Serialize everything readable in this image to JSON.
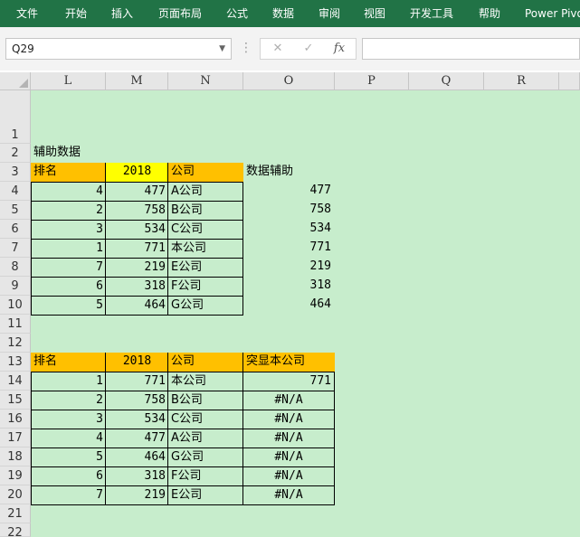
{
  "ribbon": {
    "tabs": [
      "文件",
      "开始",
      "插入",
      "页面布局",
      "公式",
      "数据",
      "审阅",
      "视图",
      "开发工具",
      "帮助",
      "Power Pivo"
    ]
  },
  "formula_bar": {
    "name_box": "Q29",
    "cancel_icon": "✕",
    "enter_icon": "✓",
    "fx_label": "fx",
    "formula": ""
  },
  "columns": [
    "L",
    "M",
    "N",
    "O",
    "P",
    "Q",
    "R"
  ],
  "rows": [
    "1",
    "2",
    "3",
    "4",
    "5",
    "6",
    "7",
    "8",
    "9",
    "10",
    "11",
    "12",
    "13",
    "14",
    "15",
    "16",
    "17",
    "18",
    "19",
    "20",
    "21",
    "22"
  ],
  "table1": {
    "caption": "辅助数据",
    "headers": [
      "排名",
      "2018",
      "公司"
    ],
    "extra_header": "数据辅助",
    "rows": [
      {
        "rank": "4",
        "value": "477",
        "company": "A公司",
        "helper": "477"
      },
      {
        "rank": "2",
        "value": "758",
        "company": "B公司",
        "helper": "758"
      },
      {
        "rank": "3",
        "value": "534",
        "company": "C公司",
        "helper": "534"
      },
      {
        "rank": "1",
        "value": "771",
        "company": "本公司",
        "helper": "771"
      },
      {
        "rank": "7",
        "value": "219",
        "company": "E公司",
        "helper": "219"
      },
      {
        "rank": "6",
        "value": "318",
        "company": "F公司",
        "helper": "318"
      },
      {
        "rank": "5",
        "value": "464",
        "company": "G公司",
        "helper": "464"
      }
    ]
  },
  "table2": {
    "headers": [
      "排名",
      "2018",
      "公司",
      "突显本公司"
    ],
    "rows": [
      {
        "rank": "1",
        "value": "771",
        "company": "本公司",
        "highlight": "771"
      },
      {
        "rank": "2",
        "value": "758",
        "company": "B公司",
        "highlight": "#N/A"
      },
      {
        "rank": "3",
        "value": "534",
        "company": "C公司",
        "highlight": "#N/A"
      },
      {
        "rank": "4",
        "value": "477",
        "company": "A公司",
        "highlight": "#N/A"
      },
      {
        "rank": "5",
        "value": "464",
        "company": "G公司",
        "highlight": "#N/A"
      },
      {
        "rank": "6",
        "value": "318",
        "company": "F公司",
        "highlight": "#N/A"
      },
      {
        "rank": "7",
        "value": "219",
        "company": "E公司",
        "highlight": "#N/A"
      }
    ]
  },
  "colors": {
    "ribbon": "#217346",
    "sheet_bg": "#c7edcc",
    "header_orange": "#ffc000",
    "header_yellow": "#ffff00"
  }
}
